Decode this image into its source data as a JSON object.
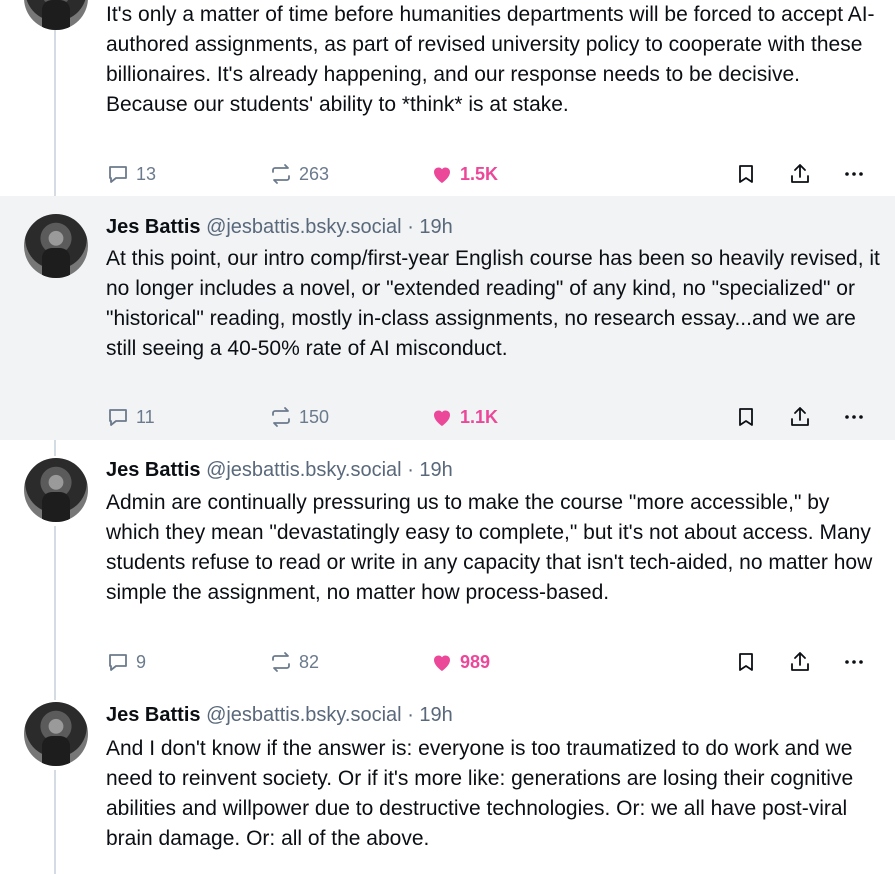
{
  "posts": [
    {
      "author": "",
      "handle": "",
      "time": "",
      "text": "It's only a matter of time before humanities departments will be forced to accept AI-authored assignments, as part of revised university policy to cooperate with these billionaires. It's already happening, and our response needs to be decisive. Because our students' ability to *think* is at stake.",
      "replies": "13",
      "reposts": "263",
      "likes": "1.5K"
    },
    {
      "author": "Jes Battis",
      "handle": "@jesbattis.bsky.social",
      "dot": "·",
      "time": "19h",
      "text": "At this point, our intro comp/first-year English course has been so heavily revised, it no longer includes a novel, or \"extended reading\" of any kind, no \"specialized\" or \"historical\" reading, mostly in-class assignments, no research essay...and we are still seeing a 40-50% rate of AI misconduct.",
      "replies": "11",
      "reposts": "150",
      "likes": "1.1K"
    },
    {
      "author": "Jes Battis",
      "handle": "@jesbattis.bsky.social",
      "dot": "·",
      "time": "19h",
      "text": "Admin are continually pressuring us to make the course \"more accessible,\" by which they mean \"devastatingly easy to complete,\" but it's not about access. Many students refuse to read or write in any capacity that isn't tech-aided, no matter how simple the assignment, no matter how process-based.",
      "replies": "9",
      "reposts": "82",
      "likes": "989"
    },
    {
      "author": "Jes Battis",
      "handle": "@jesbattis.bsky.social",
      "dot": "·",
      "time": "19h",
      "text": "And I don't know if the answer is: everyone is too traumatized to do work and we need to reinvent society.  Or if it's more like: generations are losing their cognitive abilities and willpower due to destructive technologies. Or: we all have post-viral brain damage. Or: all of the above."
    }
  ],
  "icons": {
    "reply": "speech-bubble-icon",
    "repost": "repost-arrows-icon",
    "like": "heart-icon",
    "bookmark": "bookmark-icon",
    "share": "share-icon",
    "more": "more-dots-icon"
  },
  "colors": {
    "like": "#ec4899",
    "muted": "#6b7a8c",
    "highlight_bg": "#f1f3f5",
    "thread_line": "#d4dbe2"
  }
}
